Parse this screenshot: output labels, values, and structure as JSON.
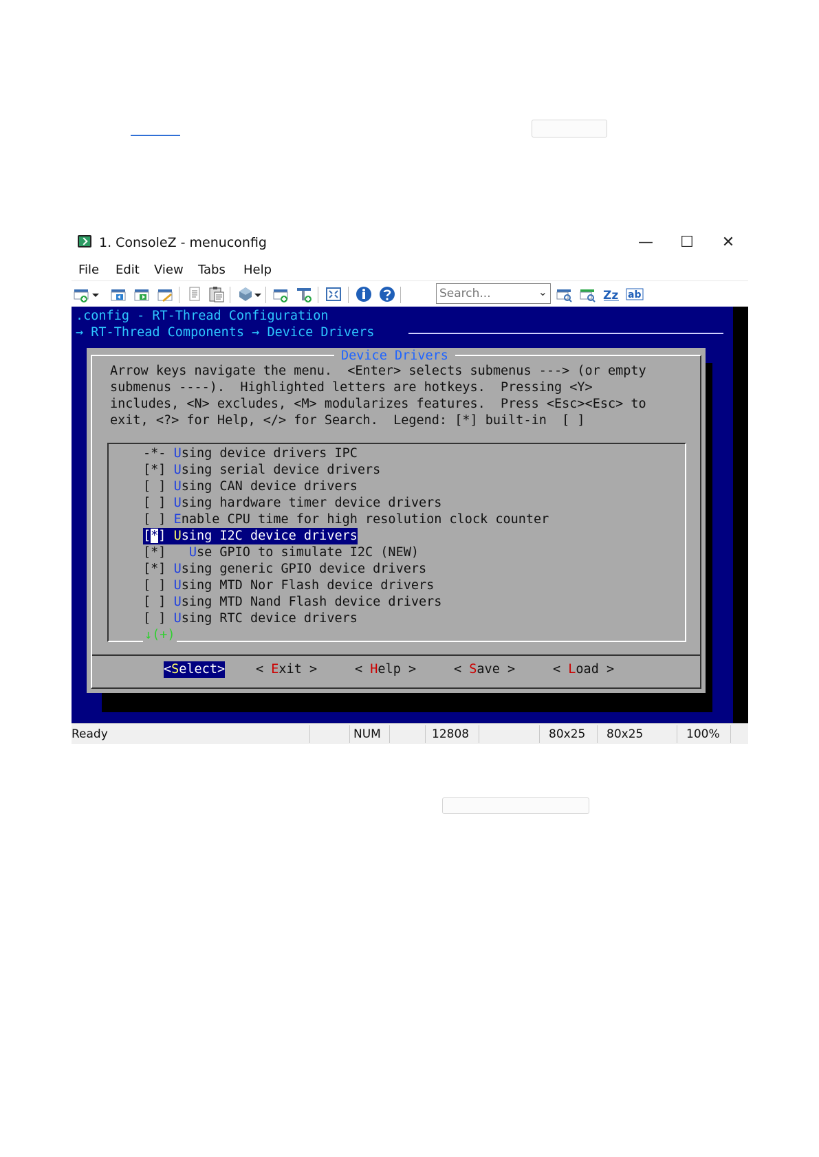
{
  "window": {
    "title": "1. ConsoleZ - menuconfig",
    "controls": {
      "minimize": "—",
      "maximize": "☐",
      "close": "✕"
    }
  },
  "menubar": [
    "File",
    "Edit",
    "View",
    "Tabs",
    "Help"
  ],
  "toolbar": {
    "icons": [
      "new-tab-icon",
      "dropdown-icon",
      "prev-tab-icon",
      "next-tab-icon",
      "rename-icon",
      "copy-icon",
      "paste-icon",
      "settings-icon",
      "dropdown-icon",
      "new-view-icon",
      "new-tab-group-icon",
      "fullscreen-icon",
      "info-icon",
      "help-icon",
      "find-prev-icon",
      "find-next-icon",
      "match-case-icon",
      "whole-word-icon"
    ],
    "search_placeholder": "Search..."
  },
  "terminal": {
    "line1": ".config - RT-Thread Configuration",
    "line2": "→ RT-Thread Components → Device Drivers",
    "dialog_title": "Device Drivers",
    "help_lines": [
      "Arrow keys navigate the menu.  <Enter> selects submenus ---> (or empty",
      "submenus ----).  Highlighted letters are hotkeys.  Pressing <Y>",
      "includes, <N> excludes, <M> modularizes features.  Press <Esc><Esc> to",
      "exit, <?> for Help, </> for Search.  Legend: [*] built-in  [ ]"
    ],
    "items": [
      {
        "box": "-*-",
        "hotkey": "U",
        "rest": "sing device drivers IPC"
      },
      {
        "box": "[*]",
        "hotkey": "U",
        "rest": "sing serial device drivers"
      },
      {
        "box": "[ ]",
        "hotkey": "U",
        "rest": "sing CAN device drivers"
      },
      {
        "box": "[ ]",
        "hotkey": "U",
        "rest": "sing hardware timer device drivers"
      },
      {
        "box": "[ ]",
        "hotkey": "E",
        "rest": "nable CPU time for high resolution clock counter"
      },
      {
        "box_left": "[",
        "box_cursor": "*",
        "box_right": "]",
        "hotkey": "U",
        "rest": "sing I2C device drivers",
        "selected": true
      },
      {
        "box": "[*]",
        "indent": "  ",
        "hotkey": "U",
        "rest": "se GPIO to simulate I2C (NEW)"
      },
      {
        "box": "[*]",
        "hotkey": "U",
        "rest": "sing generic GPIO device drivers"
      },
      {
        "box": "[ ]",
        "hotkey": "U",
        "rest": "sing MTD Nor Flash device drivers"
      },
      {
        "box": "[ ]",
        "hotkey": "U",
        "rest": "sing MTD Nand Flash device drivers"
      },
      {
        "box": "[ ]",
        "hotkey": "U",
        "rest": "sing RTC device drivers"
      }
    ],
    "more_indicator": "↓(+)",
    "buttons": [
      {
        "pre": "<",
        "hotkey": "S",
        "rest": "elect>",
        "selected": true
      },
      {
        "pre": "< ",
        "hotkey": "E",
        "rest": "xit >"
      },
      {
        "pre": "< ",
        "hotkey": "H",
        "rest": "elp >"
      },
      {
        "pre": "< ",
        "hotkey": "S",
        "rest": "ave >"
      },
      {
        "pre": "< ",
        "hotkey": "L",
        "rest": "oad >"
      }
    ]
  },
  "statusbar": {
    "status": "Ready",
    "num": "NUM",
    "pid": "12808",
    "size1": "80x25",
    "size2": "80x25",
    "zoom": "100%"
  }
}
